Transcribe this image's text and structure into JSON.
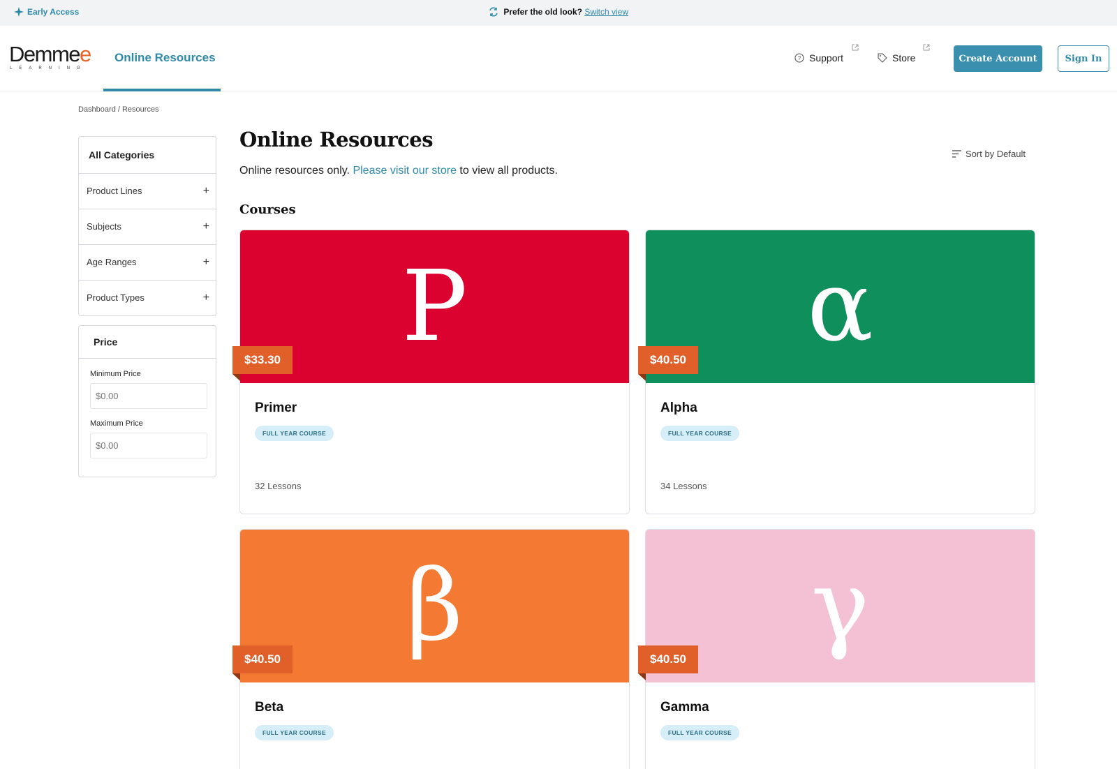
{
  "banner": {
    "early_access": "Early Access",
    "prefer_text": "Prefer the old look?",
    "switch_link": "Switch view"
  },
  "header": {
    "logo_text": "Demme",
    "logo_sub": "LEARNING",
    "nav_active": "Online Resources",
    "support": "Support",
    "store": "Store",
    "create_account": "Create Account",
    "sign_in": "Sign In"
  },
  "breadcrumb": "Dashboard / Resources",
  "sidebar": {
    "all_categories": "All Categories",
    "filters": [
      "Product Lines",
      "Subjects",
      "Age Ranges",
      "Product Types"
    ],
    "price_title": "Price",
    "min_label": "Minimum Price",
    "min_placeholder": "$0.00",
    "max_label": "Maximum Price",
    "max_placeholder": "$0.00"
  },
  "main": {
    "title": "Online Resources",
    "sort_label": "Sort by Default",
    "subtitle_before": "Online resources only. ",
    "subtitle_link": "Please visit our store",
    "subtitle_after": " to view all products.",
    "section": "Courses"
  },
  "cards": [
    {
      "name": "Primer",
      "price": "$33.30",
      "glyph": "P",
      "color": "#dc0230",
      "badge": "FULL YEAR COURSE",
      "lessons": "32 Lessons"
    },
    {
      "name": "Alpha",
      "price": "$40.50",
      "glyph": "α",
      "color": "#0e8f5c",
      "badge": "FULL YEAR COURSE",
      "lessons": "34 Lessons"
    },
    {
      "name": "Beta",
      "price": "$40.50",
      "glyph": "β",
      "color": "#f47a34",
      "badge": "FULL YEAR COURSE",
      "lessons": ""
    },
    {
      "name": "Gamma",
      "price": "$40.50",
      "glyph": "γ",
      "color": "#f4c0d3",
      "badge": "FULL YEAR COURSE",
      "lessons": ""
    }
  ],
  "colors": {
    "accent": "#2f8aa8",
    "price_tag": "#e1602a"
  }
}
